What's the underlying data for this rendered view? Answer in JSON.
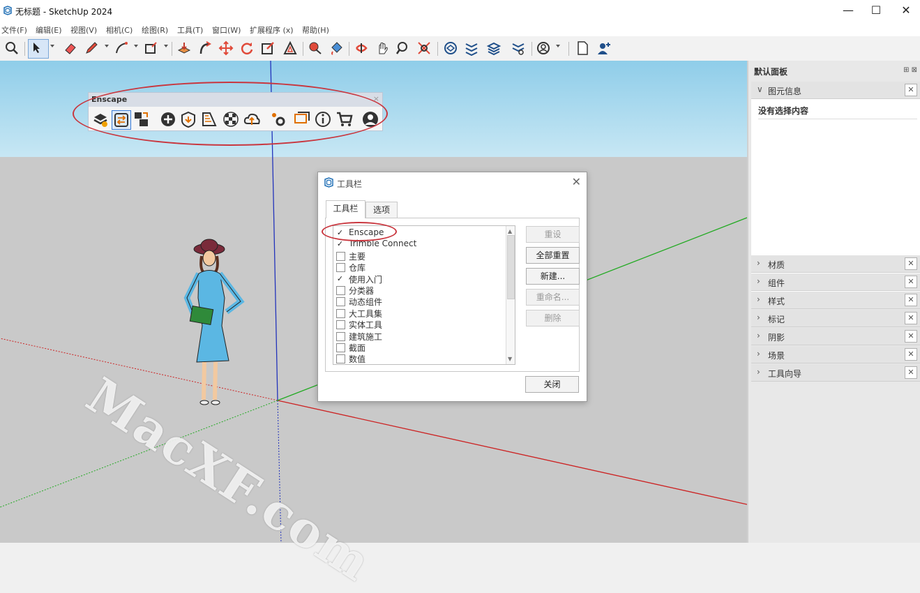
{
  "window": {
    "title": "无标题 - SketchUp 2024",
    "minimize": "—",
    "maximize": "☐",
    "close": "✕"
  },
  "menu": [
    "文件(F)",
    "编辑(E)",
    "视图(V)",
    "相机(C)",
    "绘图(R)",
    "工具(T)",
    "窗口(W)",
    "扩展程序 (x)",
    "帮助(H)"
  ],
  "enscape_toolbar": {
    "title": "Enscape",
    "close": "×"
  },
  "watermark": "MacXF.com",
  "dialog": {
    "title": "工具栏",
    "close": "✕",
    "tabs": [
      "工具栏",
      "选项"
    ],
    "items": [
      {
        "label": "Enscape",
        "checked": true
      },
      {
        "label": "Trimble Connect",
        "checked": true
      },
      {
        "label": "主要",
        "checked": false
      },
      {
        "label": "仓库",
        "checked": false
      },
      {
        "label": "使用入门",
        "checked": true
      },
      {
        "label": "分类器",
        "checked": false
      },
      {
        "label": "动态组件",
        "checked": false
      },
      {
        "label": "大工具集",
        "checked": false
      },
      {
        "label": "实体工具",
        "checked": false
      },
      {
        "label": "建筑施工",
        "checked": false
      },
      {
        "label": "截面",
        "checked": false
      },
      {
        "label": "数值",
        "checked": false
      }
    ],
    "buttons": {
      "reset": "重设",
      "reset_all": "全部重置",
      "new": "新建...",
      "rename": "重命名...",
      "delete": "删除",
      "close": "关闭"
    }
  },
  "panel": {
    "title": "默认面板",
    "entity_info": "图元信息",
    "no_selection": "没有选择内容",
    "sections": [
      "材质",
      "组件",
      "样式",
      "标记",
      "阴影",
      "场景",
      "工具向导"
    ]
  },
  "colors": {
    "sky": "#8fcde9",
    "ground": "#c9c9c9",
    "red_axis": "#cc2222",
    "green_axis": "#22aa22",
    "blue_axis": "#2233bb",
    "highlight": "#c9363e"
  }
}
